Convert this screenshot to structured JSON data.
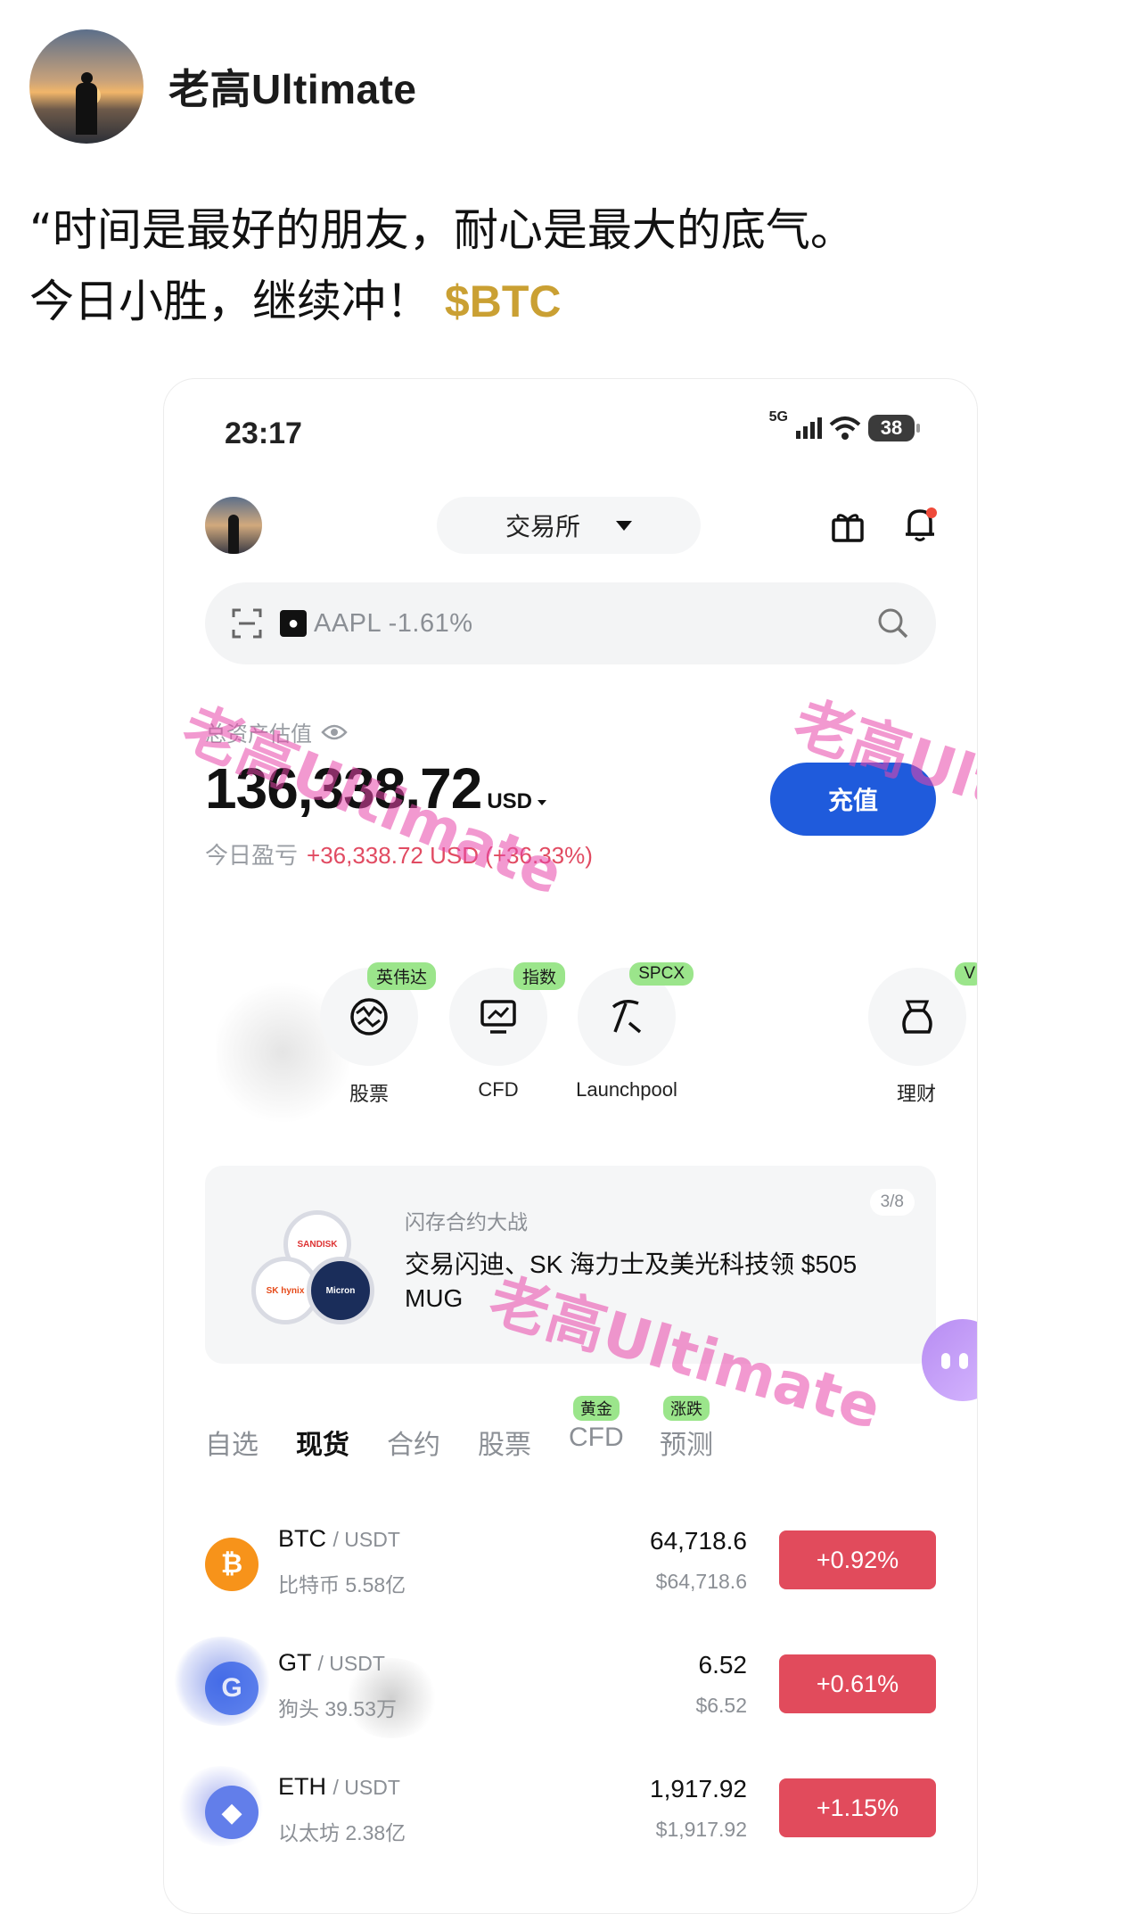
{
  "post": {
    "author": "老高Ultimate",
    "text_line1": "“时间是最好的朋友，耐心是最大的底气。",
    "text_line2": "今日小胜，继续冲！",
    "ticker_tag": "$BTC"
  },
  "status_bar": {
    "time": "23:17",
    "network": "5G",
    "battery": "38"
  },
  "topbar": {
    "exchange_label": "交易所"
  },
  "search": {
    "text": "AAPL -1.61%"
  },
  "assets": {
    "label": "总资产估值",
    "value": "136,338.72",
    "unit": "USD",
    "deposit_label": "充值",
    "pnl_label": "今日盈亏",
    "pnl_value": "+36,338.72 USD (+36.33%)"
  },
  "quick_menu": [
    {
      "label": "股票",
      "badge": "英伟达"
    },
    {
      "label": "CFD",
      "badge": "指数"
    },
    {
      "label": "Launchpool",
      "badge": "SPCX"
    },
    {
      "label": "理财",
      "badge": "V"
    }
  ],
  "banner": {
    "subtitle": "闪存合约大战",
    "title": "交易闪迪、SK 海力士及美光科技领 $505 MUG",
    "pager": "3/8",
    "logos": [
      "SANDISK",
      "SK hynix",
      "Micron"
    ]
  },
  "tabs": [
    {
      "label": "自选",
      "badge": ""
    },
    {
      "label": "现货",
      "badge": ""
    },
    {
      "label": "合约",
      "badge": ""
    },
    {
      "label": "股票",
      "badge": ""
    },
    {
      "label": "CFD",
      "badge": "黄金"
    },
    {
      "label": "预测",
      "badge": "涨跌"
    }
  ],
  "market": [
    {
      "base": "BTC",
      "quote": "/ USDT",
      "volume": "比特币 5.58亿",
      "price": "64,718.6",
      "price_usd": "$64,718.6",
      "change": "+0.92%",
      "icon": "bitcoin-icon",
      "icon_color": "#f7931a"
    },
    {
      "base": "GT",
      "quote": "/ USDT",
      "volume": "狗头 39.53万",
      "price": "6.52",
      "price_usd": "$6.52",
      "change": "+0.61%",
      "icon": "gatetoken-icon",
      "icon_color": "#2354e6"
    },
    {
      "base": "ETH",
      "quote": "/ USDT",
      "volume": "以太坊 2.38亿",
      "price": "1,917.92",
      "price_usd": "$1,917.92",
      "change": "+1.15%",
      "icon": "ethereum-icon",
      "icon_color": "#627eea"
    }
  ],
  "watermark_text": "老高Ultimate",
  "colors": {
    "accent_gold": "#caa033",
    "deposit_blue": "#1f5bdc",
    "rise_red": "#e14b5c",
    "badge_green": "#9be58b"
  }
}
